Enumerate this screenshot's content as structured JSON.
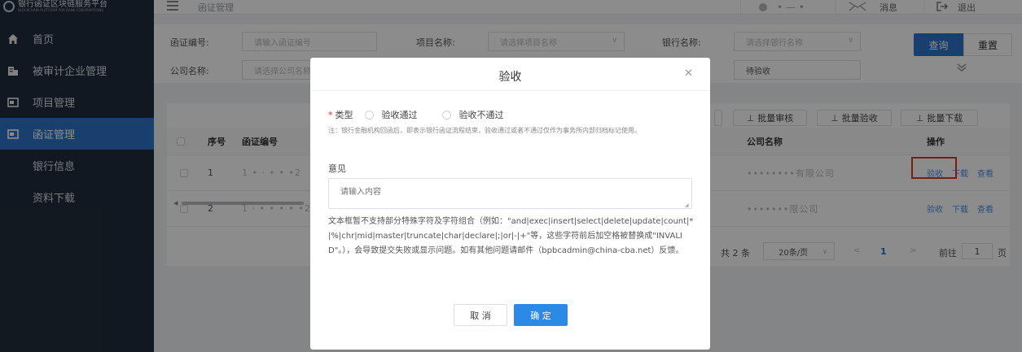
{
  "app": {
    "logo_text": "银行函证区块链服务平台",
    "logo_subtext": "BLOCKCHAIN PLATFORM FOR BANK CONFIRMATIONS"
  },
  "sidebar": {
    "items": [
      {
        "label": "首页",
        "icon": "home-icon"
      },
      {
        "label": "被审计企业管理",
        "icon": "building-icon"
      },
      {
        "label": "项目管理",
        "icon": "folder-icon"
      },
      {
        "label": "函证管理",
        "icon": "document-icon",
        "active": true
      },
      {
        "label": "银行信息",
        "sub": true
      },
      {
        "label": "资料下载",
        "sub": true
      }
    ]
  },
  "header": {
    "breadcrumb": "函证管理",
    "user_name": "• — •",
    "messages_label": "消息",
    "logout_label": "退出"
  },
  "filters": {
    "cert_no_label": "函证编号:",
    "cert_no_placeholder": "请输入函证编号",
    "project_label": "项目名称:",
    "project_placeholder": "请选择项目名称",
    "bank_label": "银行名称:",
    "bank_placeholder": "请选择银行名称",
    "company_label": "公司名称:",
    "company_placeholder": "请选择公司名称",
    "status_value": "待验收",
    "query_button": "查询",
    "reset_button": "重置"
  },
  "batch": {
    "audit": "批量审核",
    "accept": "批量验收",
    "download": "批量下载"
  },
  "table": {
    "headers": {
      "index": "序号",
      "cert_no": "函证编号",
      "company": "公司名称",
      "actions": "操作"
    },
    "rows": [
      {
        "index": "1",
        "cert_no": "1  •  ·  • • •2",
        "company": "••••••••有限公司"
      },
      {
        "index": "2",
        "cert_no": "1  · •  • • • •2",
        "company": "•••••••限公司"
      }
    ],
    "actions": {
      "accept": "验收",
      "download": "下载",
      "view": "查看"
    }
  },
  "pagination": {
    "total": "共 2 条",
    "page_size": "20条/页",
    "current": "1",
    "goto_label": "前往",
    "goto_value": "1",
    "page_unit": "页"
  },
  "modal": {
    "title": "验收",
    "type_label": "类型",
    "option_pass": "验收通过",
    "option_fail": "验收不通过",
    "note": "注：银行金融机构回函后，即表示银行函证流程结束，验收通过或者不通过仅作为事务所内部归档标记使用。",
    "opinion_label": "意见",
    "opinion_placeholder": "请输入内容",
    "warning": "文本框暂不支持部分特殊字符及字符组合（例如：\"and|exec|insert|select|delete|update|count|*|%|chr|mid|master|truncate|char|declare|;|or|-|+\"等，这些字符前后加空格被替换成\"INVALID\"。），会导致提交失败或显示问题。如有其他问题请邮件（bpbcadmin@china-cba.net）反馈。",
    "cancel_button": "取 消",
    "confirm_button": "确 定"
  },
  "colors": {
    "sidebar_bg": "#1f2d3d",
    "active_menu": "#2c74c9",
    "primary": "#2c8ae6",
    "highlight_box": "#e0331f"
  }
}
